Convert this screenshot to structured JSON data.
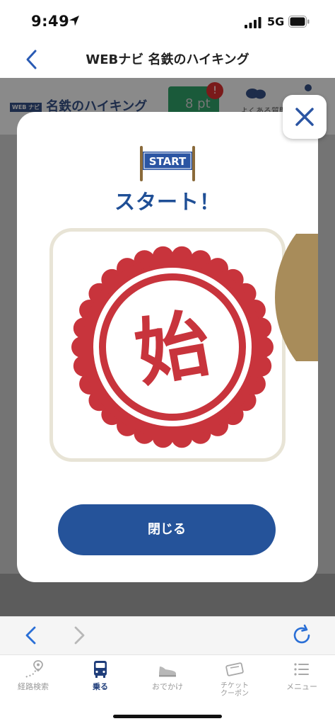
{
  "status_bar": {
    "time": "9:49",
    "network": "5G"
  },
  "header": {
    "title": "WEBナビ 名鉄のハイキング"
  },
  "background_page": {
    "logo_badge": "WEB ナビ",
    "logo_text": "名鉄のハイキング",
    "points": "8 pt",
    "notification_badge": "!",
    "faq_label": "よくある質問"
  },
  "modal": {
    "flag_text": "START",
    "title": "スタート！",
    "stamp_char": "始",
    "close_button_label": "閉じる"
  },
  "tab_bar": {
    "items": [
      {
        "label": "経路検索",
        "icon": "route-pin-icon",
        "active": false
      },
      {
        "label": "乗る",
        "icon": "bus-icon",
        "active": true
      },
      {
        "label": "おでかけ",
        "icon": "sneaker-icon",
        "active": false
      },
      {
        "label": "チケット\nクーポン",
        "icon": "ticket-icon",
        "active": false
      },
      {
        "label": "メニュー",
        "icon": "menu-list-icon",
        "active": false
      }
    ]
  },
  "colors": {
    "accent_blue": "#25539a",
    "title_blue": "#1f4f96",
    "stamp_red": "#c8343c",
    "card_border": "#e8e4d6"
  }
}
